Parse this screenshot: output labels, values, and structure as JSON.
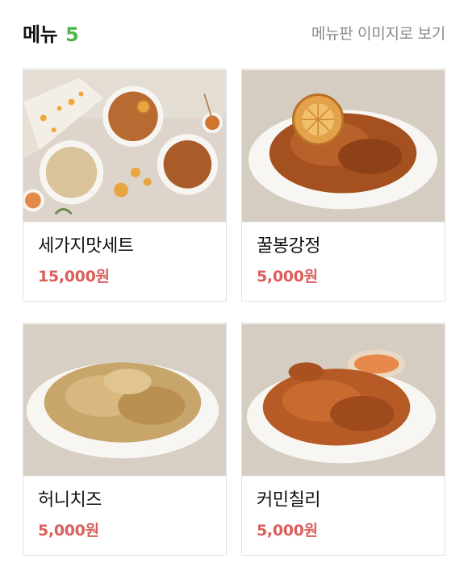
{
  "header": {
    "title": "메뉴",
    "count": "5",
    "board_link": "메뉴판 이미지로 보기"
  },
  "menu": [
    {
      "name": "세가지맛세트",
      "price": "15,000원"
    },
    {
      "name": "꿀봉강정",
      "price": "5,000원"
    },
    {
      "name": "허니치즈",
      "price": "5,000원"
    },
    {
      "name": "커민칠리",
      "price": "5,000원"
    }
  ],
  "colors": {
    "count": "#4fb548",
    "price": "#d9605c",
    "link": "#8a8a8a"
  }
}
